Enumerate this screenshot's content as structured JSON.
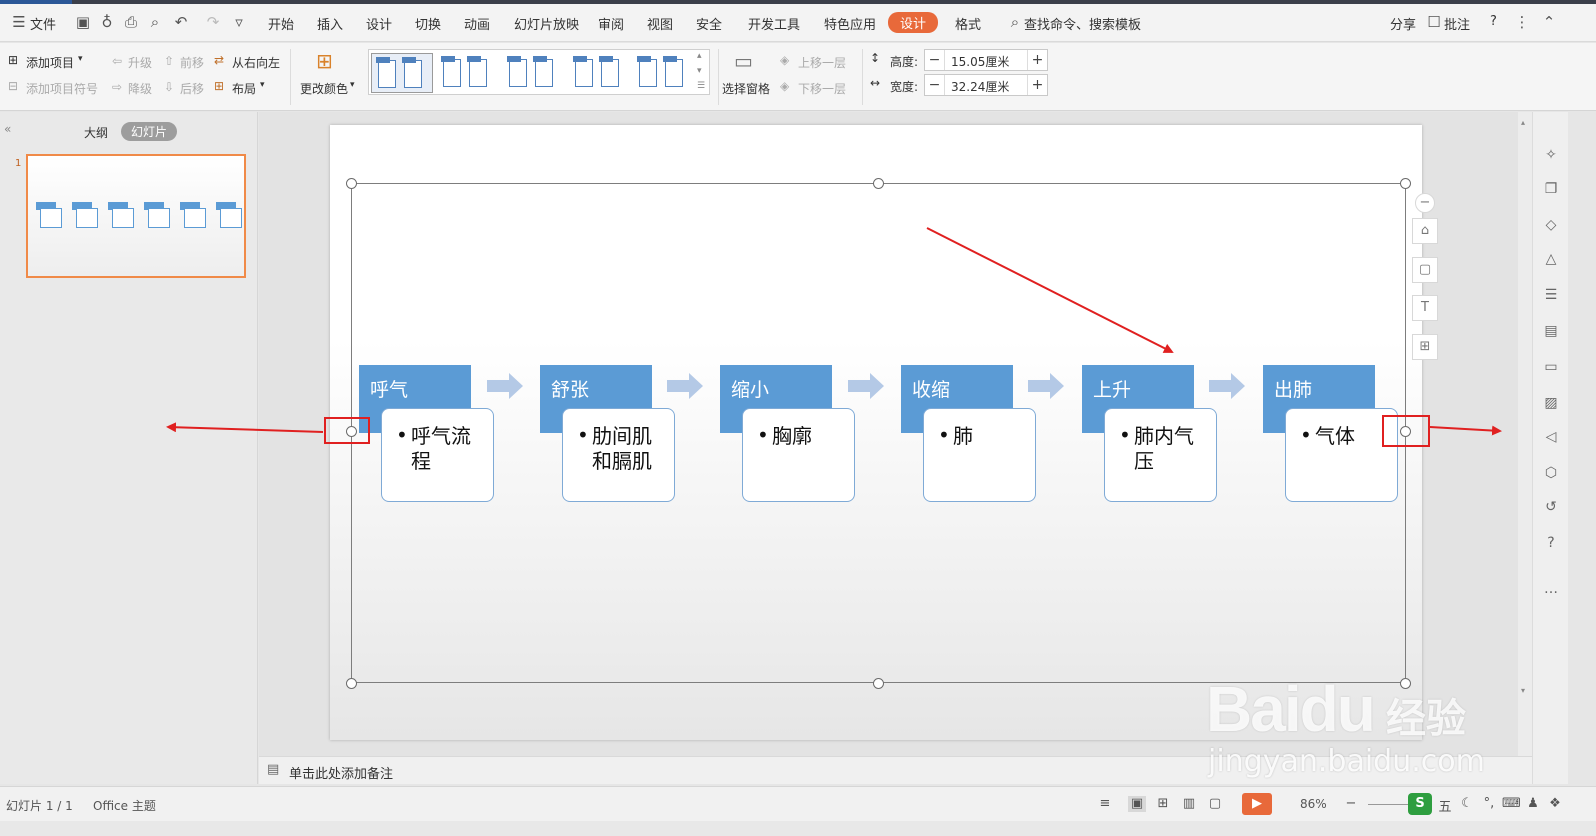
{
  "menubar": {
    "file": "文件",
    "tabs": [
      "开始",
      "插入",
      "设计",
      "切换",
      "动画",
      "幻灯片放映",
      "审阅",
      "视图",
      "安全",
      "开发工具",
      "特色应用",
      "设计",
      "格式"
    ],
    "search": "查找命令、搜索模板",
    "share": "分享",
    "comment": "批注",
    "help": "?"
  },
  "ribbon": {
    "add_item": "添加项目",
    "add_bullet": "添加项目符号",
    "promote": "升级",
    "demote": "降级",
    "move_forward": "前移",
    "move_back": "后移",
    "rtl": "从右向左",
    "layout": "布局",
    "change_color": "更改颜色",
    "select_pane": "选择窗格",
    "bring_forward": "上移一层",
    "send_backward": "下移一层",
    "height_label": "高度:",
    "height_value": "15.05厘米",
    "width_label": "宽度:",
    "width_value": "32.24厘米"
  },
  "leftpanel": {
    "tab_outline": "大纲",
    "tab_slides": "幻灯片",
    "slide_number": "1"
  },
  "smartart": {
    "steps": [
      {
        "title": "呼气",
        "body": "呼气流程"
      },
      {
        "title": "舒张",
        "body": "肋间肌和膈肌"
      },
      {
        "title": "缩小",
        "body": "胸廓"
      },
      {
        "title": "收缩",
        "body": "肺"
      },
      {
        "title": "上升",
        "body": "肺内气压"
      },
      {
        "title": "出肺",
        "body": "气体"
      }
    ],
    "bullet": "•",
    "accent_color": "#5b9bd5",
    "arrow_color": "#b4c9e6"
  },
  "notes": {
    "placeholder": "单击此处添加备注"
  },
  "statusbar": {
    "slide_info": "幻灯片 1 / 1",
    "theme": "Office 主题",
    "zoom": "86%"
  },
  "watermark": {
    "logo": "Baidu",
    "cn": "经验",
    "url": "jingyan.baidu.com"
  },
  "annotations": {
    "arrow_color": "#e02020"
  }
}
